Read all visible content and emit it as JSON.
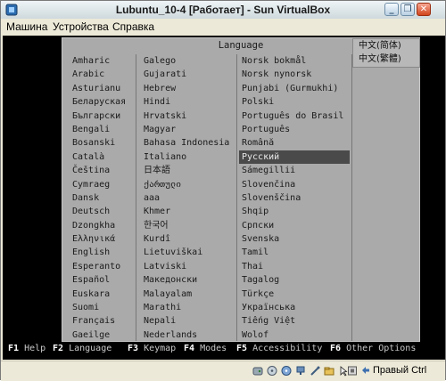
{
  "window": {
    "title": "Lubuntu_10-4 [Работает] - Sun VirtualBox"
  },
  "menubar": {
    "items": [
      {
        "label": "Машина"
      },
      {
        "label": "Устройства"
      },
      {
        "label": "Справка"
      }
    ]
  },
  "dialog": {
    "title": "Language",
    "columns": [
      [
        "Amharic",
        "Arabic",
        "Asturianu",
        "Беларуская",
        "Български",
        "Bengali",
        "Bosanski",
        "Català",
        "Čeština",
        "Cymraeg",
        "Dansk",
        "Deutsch",
        "Dzongkha",
        "Ελληνικά",
        "English",
        "Esperanto",
        "Español",
        "Euskara",
        "Suomi",
        "Français",
        "Gaeilge"
      ],
      [
        "Galego",
        "Gujarati",
        "Hebrew",
        "Hindi",
        "Hrvatski",
        "Magyar",
        "Bahasa Indonesia",
        "Italiano",
        "日本語",
        "ქართული",
        "ааа",
        "Khmer",
        "한국어",
        "Kurdî",
        "Lietuviškai",
        "Latviski",
        "Македонски",
        "Malayalam",
        "Marathi",
        "Nepali",
        "Nederlands"
      ],
      [
        "Norsk bokmål",
        "Norsk nynorsk",
        "Punjabi (Gurmukhi)",
        "Polski",
        "Português do Brasil",
        "Português",
        "Română",
        "Русский",
        "Sámegillii",
        "Slovenčina",
        "Slovenščina",
        "Shqip",
        "Српски",
        "Svenska",
        "Tamil",
        "Thai",
        "Tagalog",
        "Türkçe",
        "Українська",
        "Tiếng Việt",
        "Wolof"
      ],
      [
        "中文(简体)",
        "中文(繁體)"
      ]
    ],
    "selected": "Русский"
  },
  "fkeys": [
    {
      "key": "F1",
      "label": "Help"
    },
    {
      "key": "F2",
      "label": "Language"
    },
    {
      "key": "F3",
      "label": "Keymap"
    },
    {
      "key": "F4",
      "label": "Modes"
    },
    {
      "key": "F5",
      "label": "Accessibility"
    },
    {
      "key": "F6",
      "label": "Other Options"
    }
  ],
  "statusbar": {
    "host_key": "Правый Ctrl",
    "icons": [
      "hard-disk-icon",
      "cd-drive-icon",
      "floppy-icon",
      "network-icon",
      "usb-icon",
      "shared-folders-icon",
      "mouse-integration-icon",
      "virtualization-icon"
    ]
  },
  "colors": {
    "selection": "#4a4a4a",
    "dialog_bg": "#aaaaaa",
    "screen_bg": "#000000"
  }
}
